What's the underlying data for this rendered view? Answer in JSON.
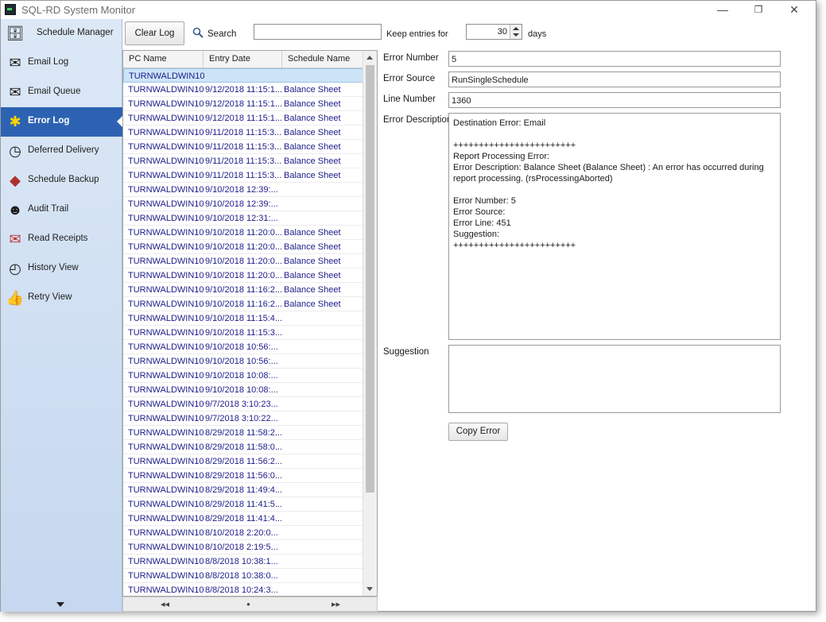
{
  "window": {
    "title": "SQL-RD System Monitor",
    "controls": {
      "minimize": "—",
      "maximize": "❐",
      "close": "✕"
    }
  },
  "sidebar": {
    "items": [
      {
        "label": "Schedule Manager",
        "icon": "database-clock-icon"
      },
      {
        "label": "Email Log",
        "icon": "email-icon"
      },
      {
        "label": "Email Queue",
        "icon": "email-warning-icon"
      },
      {
        "label": "Error Log",
        "icon": "bug-icon",
        "active": true
      },
      {
        "label": "Deferred Delivery",
        "icon": "server-clock-icon"
      },
      {
        "label": "Schedule Backup",
        "icon": "backup-icon"
      },
      {
        "label": "Audit Trail",
        "icon": "agent-icon"
      },
      {
        "label": "Read Receipts",
        "icon": "receipt-icon"
      },
      {
        "label": "History View",
        "icon": "history-icon"
      },
      {
        "label": "Retry View",
        "icon": "thumbs-up-icon"
      }
    ]
  },
  "toolbar": {
    "clear_log": "Clear Log",
    "search_label": "Search",
    "search_value": "",
    "keep_label": "Keep entries for",
    "keep_value": "30",
    "days_label": "days"
  },
  "grid": {
    "columns": [
      "PC Name",
      "Entry Date",
      "Schedule Name"
    ],
    "rows": [
      [
        "TURNWALDWIN10",
        "",
        ""
      ],
      [
        "TURNWALDWIN10",
        "9/12/2018 11:15:1...",
        "Balance Sheet"
      ],
      [
        "TURNWALDWIN10",
        "9/12/2018 11:15:1...",
        "Balance Sheet"
      ],
      [
        "TURNWALDWIN10",
        "9/12/2018 11:15:1...",
        "Balance Sheet"
      ],
      [
        "TURNWALDWIN10",
        "9/11/2018 11:15:3...",
        "Balance Sheet"
      ],
      [
        "TURNWALDWIN10",
        "9/11/2018 11:15:3...",
        "Balance Sheet"
      ],
      [
        "TURNWALDWIN10",
        "9/11/2018 11:15:3...",
        "Balance Sheet"
      ],
      [
        "TURNWALDWIN10",
        "9/11/2018 11:15:3...",
        "Balance Sheet"
      ],
      [
        "TURNWALDWIN10",
        "9/10/2018 12:39:...",
        ""
      ],
      [
        "TURNWALDWIN10",
        "9/10/2018 12:39:...",
        ""
      ],
      [
        "TURNWALDWIN10",
        "9/10/2018 12:31:...",
        ""
      ],
      [
        "TURNWALDWIN10",
        "9/10/2018 11:20:0...",
        "Balance Sheet"
      ],
      [
        "TURNWALDWIN10",
        "9/10/2018 11:20:0...",
        "Balance Sheet"
      ],
      [
        "TURNWALDWIN10",
        "9/10/2018 11:20:0...",
        "Balance Sheet"
      ],
      [
        "TURNWALDWIN10",
        "9/10/2018 11:20:0...",
        "Balance Sheet"
      ],
      [
        "TURNWALDWIN10",
        "9/10/2018 11:16:2...",
        "Balance Sheet"
      ],
      [
        "TURNWALDWIN10",
        "9/10/2018 11:16:2...",
        "Balance Sheet"
      ],
      [
        "TURNWALDWIN10",
        "9/10/2018 11:15:4...",
        ""
      ],
      [
        "TURNWALDWIN10",
        "9/10/2018 11:15:3...",
        ""
      ],
      [
        "TURNWALDWIN10",
        "9/10/2018 10:56:...",
        ""
      ],
      [
        "TURNWALDWIN10",
        "9/10/2018 10:56:...",
        ""
      ],
      [
        "TURNWALDWIN10",
        "9/10/2018 10:08:...",
        ""
      ],
      [
        "TURNWALDWIN10",
        "9/10/2018 10:08:...",
        ""
      ],
      [
        "TURNWALDWIN10",
        "9/7/2018 3:10:23...",
        ""
      ],
      [
        "TURNWALDWIN10",
        "9/7/2018 3:10:22...",
        ""
      ],
      [
        "TURNWALDWIN10",
        "8/29/2018 11:58:2...",
        ""
      ],
      [
        "TURNWALDWIN10",
        "8/29/2018 11:58:0...",
        ""
      ],
      [
        "TURNWALDWIN10",
        "8/29/2018 11:56:2...",
        ""
      ],
      [
        "TURNWALDWIN10",
        "8/29/2018 11:56:0...",
        ""
      ],
      [
        "TURNWALDWIN10",
        "8/29/2018 11:49:4...",
        ""
      ],
      [
        "TURNWALDWIN10",
        "8/29/2018 11:41:5...",
        ""
      ],
      [
        "TURNWALDWIN10",
        "8/29/2018 11:41:4...",
        ""
      ],
      [
        "TURNWALDWIN10",
        "8/10/2018 2:20:0...",
        ""
      ],
      [
        "TURNWALDWIN10",
        "8/10/2018 2:19:5...",
        ""
      ],
      [
        "TURNWALDWIN10",
        "8/8/2018 10:38:1...",
        ""
      ],
      [
        "TURNWALDWIN10",
        "8/8/2018 10:38:0...",
        ""
      ],
      [
        "TURNWALDWIN10",
        "8/8/2018 10:24:3...",
        ""
      ]
    ],
    "footer": {
      "prev": "◂◂",
      "dot": "●",
      "next": "▸▸"
    }
  },
  "detail": {
    "error_number_label": "Error Number",
    "error_number": "5",
    "error_source_label": "Error Source",
    "error_source": "RunSingleSchedule",
    "line_number_label": "Line Number",
    "line_number": "1360",
    "error_description_label": "Error Description",
    "error_description": "Destination Error: Email\n\n++++++++++++++++++++++++\nReport Processing Error:\nError Description: Balance Sheet (Balance Sheet) : An error has occurred during report processing. (rsProcessingAborted)\n\nError Number: 5\nError Source:\nError Line: 451\nSuggestion:\n++++++++++++++++++++++++",
    "suggestion_label": "Suggestion",
    "suggestion": "",
    "copy_error": "Copy Error"
  }
}
